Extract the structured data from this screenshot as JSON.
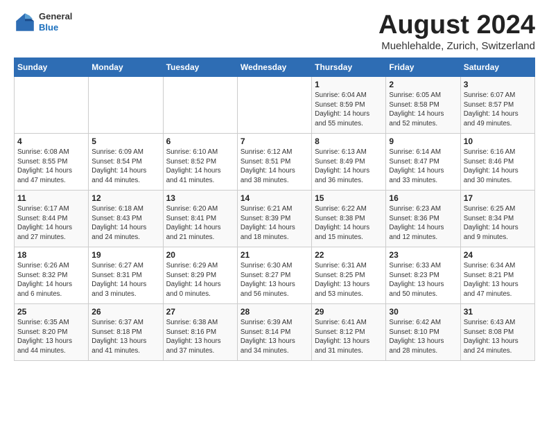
{
  "logo": {
    "general": "General",
    "blue": "Blue"
  },
  "title": "August 2024",
  "subtitle": "Muehlehalde, Zurich, Switzerland",
  "days_of_week": [
    "Sunday",
    "Monday",
    "Tuesday",
    "Wednesday",
    "Thursday",
    "Friday",
    "Saturday"
  ],
  "weeks": [
    [
      {
        "day": "",
        "info": ""
      },
      {
        "day": "",
        "info": ""
      },
      {
        "day": "",
        "info": ""
      },
      {
        "day": "",
        "info": ""
      },
      {
        "day": "1",
        "info": "Sunrise: 6:04 AM\nSunset: 8:59 PM\nDaylight: 14 hours\nand 55 minutes."
      },
      {
        "day": "2",
        "info": "Sunrise: 6:05 AM\nSunset: 8:58 PM\nDaylight: 14 hours\nand 52 minutes."
      },
      {
        "day": "3",
        "info": "Sunrise: 6:07 AM\nSunset: 8:57 PM\nDaylight: 14 hours\nand 49 minutes."
      }
    ],
    [
      {
        "day": "4",
        "info": "Sunrise: 6:08 AM\nSunset: 8:55 PM\nDaylight: 14 hours\nand 47 minutes."
      },
      {
        "day": "5",
        "info": "Sunrise: 6:09 AM\nSunset: 8:54 PM\nDaylight: 14 hours\nand 44 minutes."
      },
      {
        "day": "6",
        "info": "Sunrise: 6:10 AM\nSunset: 8:52 PM\nDaylight: 14 hours\nand 41 minutes."
      },
      {
        "day": "7",
        "info": "Sunrise: 6:12 AM\nSunset: 8:51 PM\nDaylight: 14 hours\nand 38 minutes."
      },
      {
        "day": "8",
        "info": "Sunrise: 6:13 AM\nSunset: 8:49 PM\nDaylight: 14 hours\nand 36 minutes."
      },
      {
        "day": "9",
        "info": "Sunrise: 6:14 AM\nSunset: 8:47 PM\nDaylight: 14 hours\nand 33 minutes."
      },
      {
        "day": "10",
        "info": "Sunrise: 6:16 AM\nSunset: 8:46 PM\nDaylight: 14 hours\nand 30 minutes."
      }
    ],
    [
      {
        "day": "11",
        "info": "Sunrise: 6:17 AM\nSunset: 8:44 PM\nDaylight: 14 hours\nand 27 minutes."
      },
      {
        "day": "12",
        "info": "Sunrise: 6:18 AM\nSunset: 8:43 PM\nDaylight: 14 hours\nand 24 minutes."
      },
      {
        "day": "13",
        "info": "Sunrise: 6:20 AM\nSunset: 8:41 PM\nDaylight: 14 hours\nand 21 minutes."
      },
      {
        "day": "14",
        "info": "Sunrise: 6:21 AM\nSunset: 8:39 PM\nDaylight: 14 hours\nand 18 minutes."
      },
      {
        "day": "15",
        "info": "Sunrise: 6:22 AM\nSunset: 8:38 PM\nDaylight: 14 hours\nand 15 minutes."
      },
      {
        "day": "16",
        "info": "Sunrise: 6:23 AM\nSunset: 8:36 PM\nDaylight: 14 hours\nand 12 minutes."
      },
      {
        "day": "17",
        "info": "Sunrise: 6:25 AM\nSunset: 8:34 PM\nDaylight: 14 hours\nand 9 minutes."
      }
    ],
    [
      {
        "day": "18",
        "info": "Sunrise: 6:26 AM\nSunset: 8:32 PM\nDaylight: 14 hours\nand 6 minutes."
      },
      {
        "day": "19",
        "info": "Sunrise: 6:27 AM\nSunset: 8:31 PM\nDaylight: 14 hours\nand 3 minutes."
      },
      {
        "day": "20",
        "info": "Sunrise: 6:29 AM\nSunset: 8:29 PM\nDaylight: 14 hours\nand 0 minutes."
      },
      {
        "day": "21",
        "info": "Sunrise: 6:30 AM\nSunset: 8:27 PM\nDaylight: 13 hours\nand 56 minutes."
      },
      {
        "day": "22",
        "info": "Sunrise: 6:31 AM\nSunset: 8:25 PM\nDaylight: 13 hours\nand 53 minutes."
      },
      {
        "day": "23",
        "info": "Sunrise: 6:33 AM\nSunset: 8:23 PM\nDaylight: 13 hours\nand 50 minutes."
      },
      {
        "day": "24",
        "info": "Sunrise: 6:34 AM\nSunset: 8:21 PM\nDaylight: 13 hours\nand 47 minutes."
      }
    ],
    [
      {
        "day": "25",
        "info": "Sunrise: 6:35 AM\nSunset: 8:20 PM\nDaylight: 13 hours\nand 44 minutes."
      },
      {
        "day": "26",
        "info": "Sunrise: 6:37 AM\nSunset: 8:18 PM\nDaylight: 13 hours\nand 41 minutes."
      },
      {
        "day": "27",
        "info": "Sunrise: 6:38 AM\nSunset: 8:16 PM\nDaylight: 13 hours\nand 37 minutes."
      },
      {
        "day": "28",
        "info": "Sunrise: 6:39 AM\nSunset: 8:14 PM\nDaylight: 13 hours\nand 34 minutes."
      },
      {
        "day": "29",
        "info": "Sunrise: 6:41 AM\nSunset: 8:12 PM\nDaylight: 13 hours\nand 31 minutes."
      },
      {
        "day": "30",
        "info": "Sunrise: 6:42 AM\nSunset: 8:10 PM\nDaylight: 13 hours\nand 28 minutes."
      },
      {
        "day": "31",
        "info": "Sunrise: 6:43 AM\nSunset: 8:08 PM\nDaylight: 13 hours\nand 24 minutes."
      }
    ]
  ]
}
